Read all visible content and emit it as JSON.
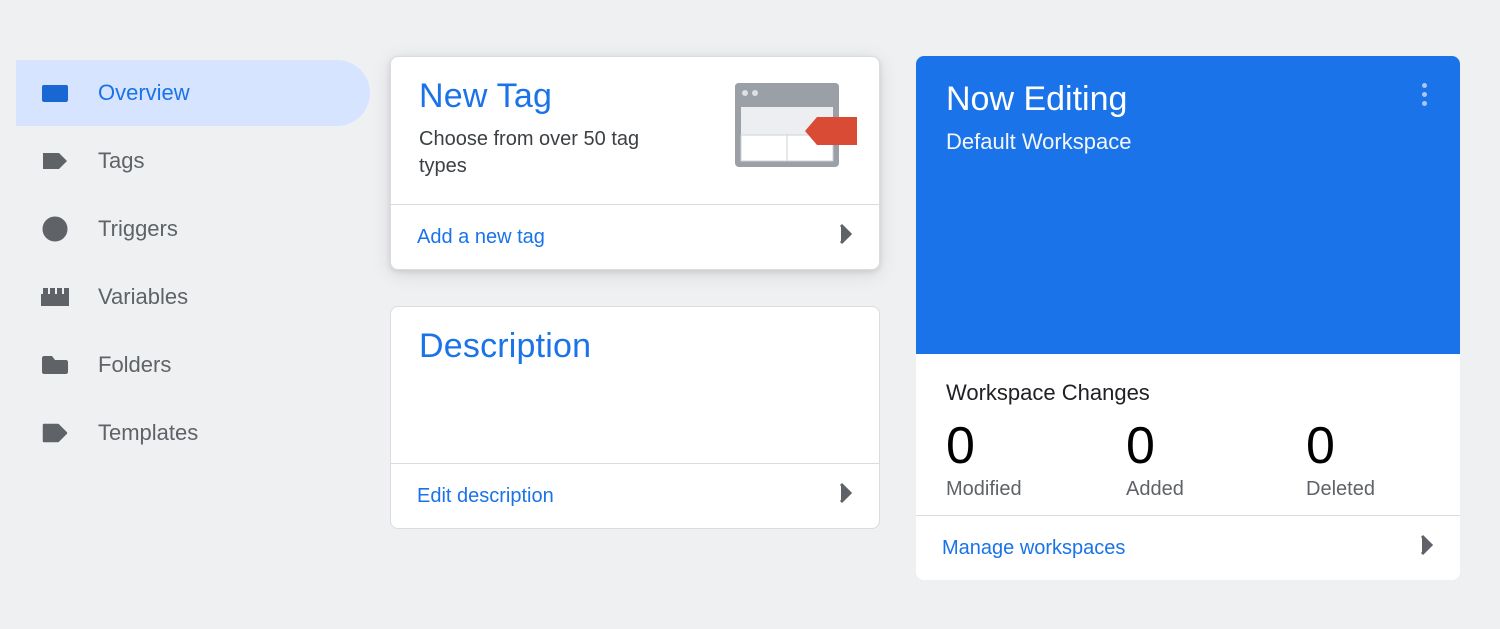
{
  "sidebar": {
    "items": [
      {
        "label": "Overview",
        "icon": "overview-icon",
        "active": true
      },
      {
        "label": "Tags",
        "icon": "tag-icon",
        "active": false
      },
      {
        "label": "Triggers",
        "icon": "trigger-icon",
        "active": false
      },
      {
        "label": "Variables",
        "icon": "variables-icon",
        "active": false
      },
      {
        "label": "Folders",
        "icon": "folder-icon",
        "active": false
      },
      {
        "label": "Templates",
        "icon": "template-icon",
        "active": false
      }
    ]
  },
  "newTag": {
    "title": "New Tag",
    "subtitle": "Choose from over 50 tag types",
    "action": "Add a new tag"
  },
  "description": {
    "title": "Description",
    "action": "Edit description"
  },
  "editing": {
    "header": "Now Editing",
    "workspace": "Default Workspace",
    "changesTitle": "Workspace Changes",
    "stats": [
      {
        "value": "0",
        "label": "Modified"
      },
      {
        "value": "0",
        "label": "Added"
      },
      {
        "value": "0",
        "label": "Deleted"
      }
    ],
    "action": "Manage workspaces"
  },
  "colors": {
    "accent": "#1a73e8",
    "activeNavBg": "#d6e4ff",
    "textMuted": "#5f6368",
    "border": "#dadce0",
    "bg": "#eef0f2"
  }
}
